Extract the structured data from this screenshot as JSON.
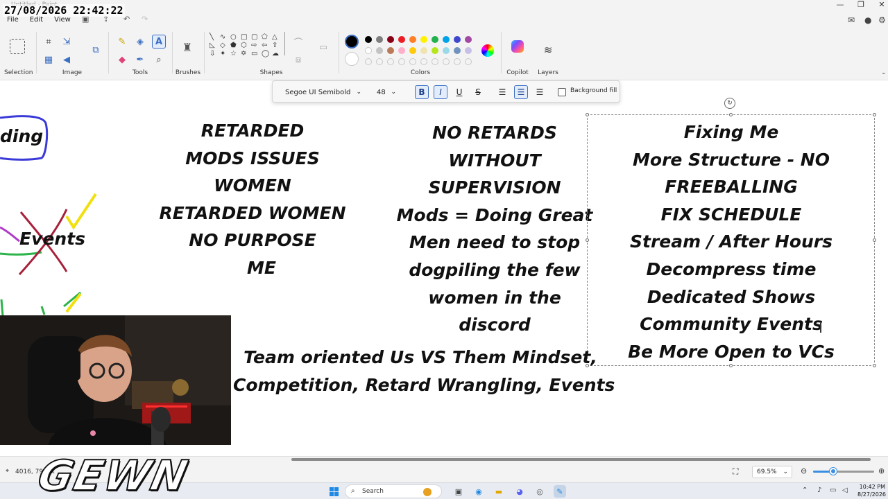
{
  "window": {
    "title": "Untitled - Paint",
    "menu": [
      "File",
      "Edit",
      "View"
    ]
  },
  "overlay": {
    "timestamp": "27/08/2026 22:42:22",
    "logo_text": "GEWN"
  },
  "ribbon": {
    "groups": [
      "Selection",
      "Image",
      "Tools",
      "Brushes",
      "Shapes",
      "Colors",
      "Copilot",
      "Layers"
    ]
  },
  "colors": {
    "primary": "#000000",
    "secondary": "#ffffff",
    "row1": [
      "#000000",
      "#7f7f7f",
      "#880015",
      "#ed1c24",
      "#ff7f27",
      "#fff200",
      "#22b14c",
      "#00a2e8",
      "#3f48cc",
      "#a349a4"
    ],
    "row2": [
      "#ffffff",
      "#c3c3c3",
      "#b97a57",
      "#ffaec9",
      "#ffc90e",
      "#efe4b0",
      "#b5e61d",
      "#99d9ea",
      "#7092be",
      "#c8bfe7"
    ]
  },
  "text_toolbar": {
    "font": "Segoe UI Semibold",
    "size": "48",
    "background_fill_label": "Background fill",
    "background_fill_checked": false,
    "bold": true,
    "italic": true,
    "underline": false,
    "strike": false,
    "align": "center"
  },
  "canvas": {
    "partial_words": [
      "ding",
      "Events"
    ],
    "column1": [
      "RETARDED",
      "MODS ISSUES",
      "WOMEN",
      "RETARDED WOMEN",
      "NO PURPOSE",
      "ME"
    ],
    "column2": [
      "NO RETARDS",
      "WITHOUT",
      "SUPERVISION",
      "Mods = Doing Great",
      "Men need to stop",
      "dogpiling the few",
      "women in the",
      "discord"
    ],
    "column3": [
      "Fixing Me",
      "More Structure - NO",
      "FREEBALLING",
      "FIX SCHEDULE",
      "Stream / After Hours",
      "Decompress time",
      "Dedicated Shows",
      "Community Events",
      "Be More Open to VCs"
    ],
    "bottom_lines": [
      "Team oriented Us VS Them Mindset,",
      "Competition, Retard Wrangling, Events"
    ]
  },
  "statusbar": {
    "coords": "4016, 796px",
    "size_suffix": "px",
    "zoom": "69.5%",
    "zoom_fraction": 0.35
  },
  "taskbar": {
    "search_placeholder": "Search",
    "time": "10:42 PM",
    "date": "8/27/2026"
  }
}
